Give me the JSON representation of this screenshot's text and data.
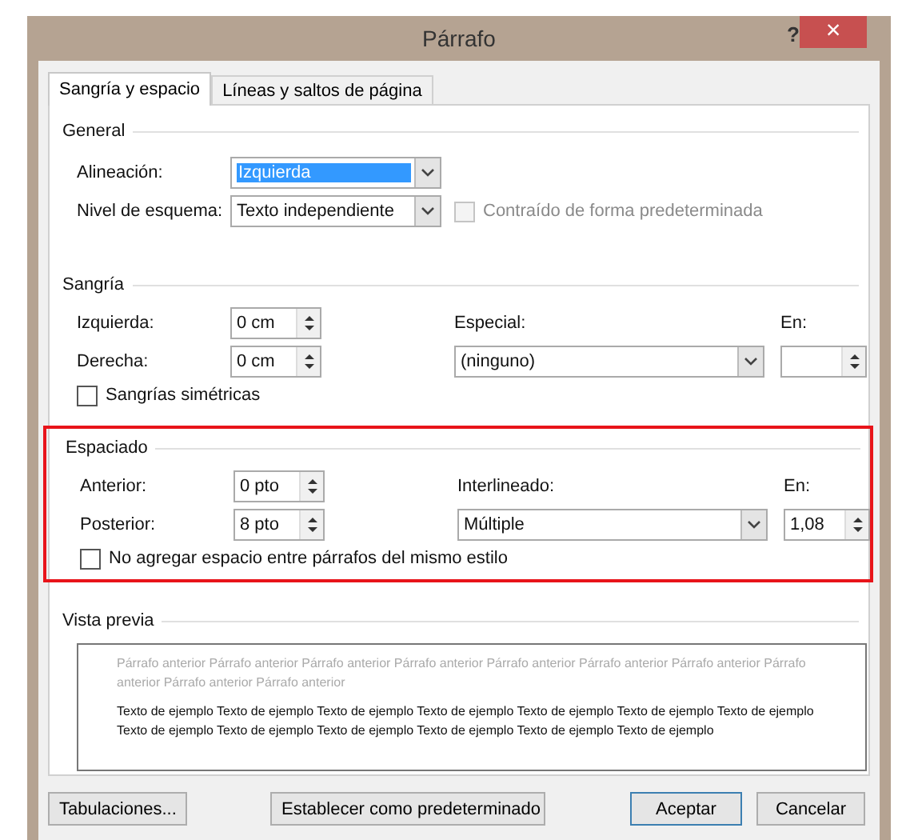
{
  "window": {
    "title": "Párrafo",
    "help": "?",
    "close": "×"
  },
  "tabs": [
    {
      "label": "Sangría y espacio",
      "selected": true
    },
    {
      "label": "Líneas y saltos de página",
      "selected": false
    }
  ],
  "general": {
    "title": "General",
    "alignment": {
      "label": "Alineación:",
      "value": "Izquierda",
      "highlighted": true
    },
    "outline_level": {
      "label": "Nivel de esquema:",
      "value": "Texto independiente",
      "highlighted": false
    },
    "collapsed": {
      "label": "Contraído de forma predeterminada",
      "checked": false,
      "disabled": true
    }
  },
  "indentation": {
    "title": "Sangría",
    "left": {
      "label": "Izquierda:",
      "value": "0 cm"
    },
    "right": {
      "label": "Derecha:",
      "value": "0 cm"
    },
    "special": {
      "label": "Especial:",
      "value": "(ninguno)"
    },
    "by": {
      "label": "En:"
    },
    "mirror": {
      "label": "Sangrías simétricas",
      "checked": false,
      "disabled": false
    }
  },
  "spacing": {
    "title": "Espaciado",
    "highlighted": true,
    "before": {
      "label": "Anterior:",
      "value": "0 pto"
    },
    "after": {
      "label": "Posterior:",
      "value": "8 pto"
    },
    "line_spacing": {
      "label": "Interlineado:",
      "value": "Múltiple"
    },
    "at": {
      "label": "En:",
      "value": "1,08"
    },
    "no_space": {
      "label": "No agregar espacio entre párrafos del mismo estilo",
      "checked": false,
      "disabled": false
    }
  },
  "preview": {
    "title": "Vista previa",
    "previous_text": "Párrafo anterior Párrafo anterior Párrafo anterior Párrafo anterior Párrafo anterior Párrafo anterior Párrafo anterior Párrafo anterior Párrafo anterior Párrafo anterior",
    "sample_text": "Texto de ejemplo Texto de ejemplo Texto de ejemplo Texto de ejemplo Texto de ejemplo Texto de ejemplo Texto de ejemplo Texto de ejemplo Texto de ejemplo Texto de ejemplo Texto de ejemplo Texto de ejemplo Texto de ejemplo"
  },
  "buttons": [
    {
      "label": "Tabulaciones...",
      "default": false
    },
    {
      "label": "Establecer como predeterminado",
      "default": false
    },
    {
      "label": "Aceptar",
      "default": true
    },
    {
      "label": "Cancelar",
      "default": false
    }
  ]
}
